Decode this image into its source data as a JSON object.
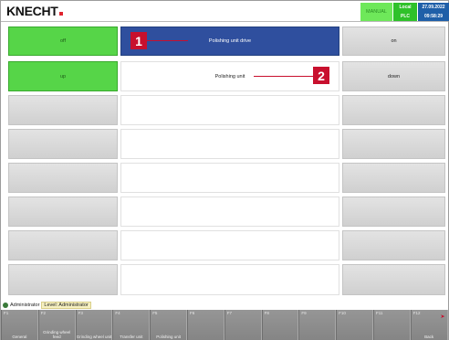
{
  "header": {
    "logo": "KNECHT",
    "mode": "MANUAL",
    "control_line1": "Local",
    "control_line2": "PLC",
    "date": "27.09.2022",
    "time": "09:58:29"
  },
  "rows": [
    {
      "left": "off",
      "center": "Polishing unit drive",
      "right": "on"
    },
    {
      "left": "up",
      "center": "Polishing unit",
      "right": "down"
    },
    {
      "left": "",
      "center": "",
      "right": ""
    },
    {
      "left": "",
      "center": "",
      "right": ""
    },
    {
      "left": "",
      "center": "",
      "right": ""
    },
    {
      "left": "",
      "center": "",
      "right": ""
    },
    {
      "left": "",
      "center": "",
      "right": ""
    },
    {
      "left": "",
      "center": "",
      "right": ""
    }
  ],
  "callouts": [
    "1",
    "2"
  ],
  "status": {
    "user": "Administrator",
    "level": "Level: Administrator"
  },
  "function_keys": [
    {
      "num": "F1",
      "label": "General"
    },
    {
      "num": "F2",
      "label": "Grinding wheel feed"
    },
    {
      "num": "F3",
      "label": "Grinding wheel unit"
    },
    {
      "num": "F4",
      "label": "Transfer unit"
    },
    {
      "num": "F5",
      "label": "Polishing unit"
    },
    {
      "num": "F6",
      "label": ""
    },
    {
      "num": "F7",
      "label": ""
    },
    {
      "num": "F8",
      "label": ""
    },
    {
      "num": "F9",
      "label": ""
    },
    {
      "num": "F10",
      "label": ""
    },
    {
      "num": "F11",
      "label": ""
    },
    {
      "num": "F12",
      "label": "Back"
    }
  ],
  "colors": {
    "green": "#56d548",
    "blue": "#2f4f9e",
    "callout": "#c8102e"
  }
}
